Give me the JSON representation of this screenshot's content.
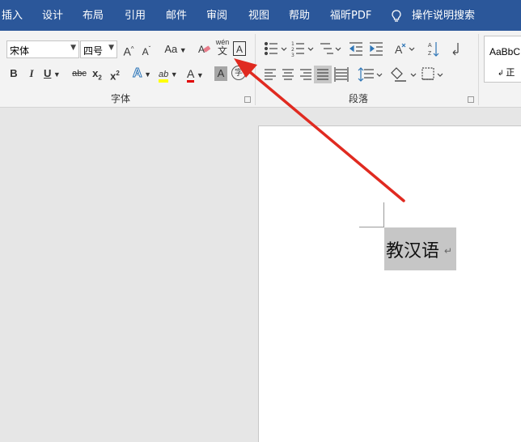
{
  "menu": {
    "items": [
      {
        "name": "menu-insert",
        "label": "插入"
      },
      {
        "name": "menu-design",
        "label": "设计"
      },
      {
        "name": "menu-layout",
        "label": "布局"
      },
      {
        "name": "menu-references",
        "label": "引用"
      },
      {
        "name": "menu-mailings",
        "label": "邮件"
      },
      {
        "name": "menu-review",
        "label": "审阅"
      },
      {
        "name": "menu-view",
        "label": "视图"
      },
      {
        "name": "menu-help",
        "label": "帮助"
      },
      {
        "name": "menu-foxit-pdf",
        "label": "福昕PDF"
      }
    ],
    "tell_me": "操作说明搜索"
  },
  "font_group": {
    "label": "字体",
    "font_name": "宋体",
    "font_size": "四号",
    "buttons": {
      "grow": "A",
      "shrink": "A",
      "change_case": "Aa",
      "phonetic_pinyin": "wén",
      "phonetic_char": "文",
      "char_border": "A",
      "bold": "B",
      "italic": "I",
      "underline": "U",
      "strike": "abc",
      "subscript": "x",
      "superscript": "x",
      "text_effects": "A",
      "highlight": "ab",
      "font_color": "A",
      "char_shading": "A",
      "enclose_char": "字"
    }
  },
  "paragraph_group": {
    "label": "段落"
  },
  "styles_group": {
    "sample": "AaBbC",
    "name": "正"
  },
  "document": {
    "text": "教汉语",
    "para_mark": "↵"
  },
  "colors": {
    "menubar": "#2b579a",
    "annotation_arrow": "#e02a20",
    "highlight_yellow": "#ffff00",
    "font_red": "#e00000",
    "selection": "#c6c6c6"
  }
}
